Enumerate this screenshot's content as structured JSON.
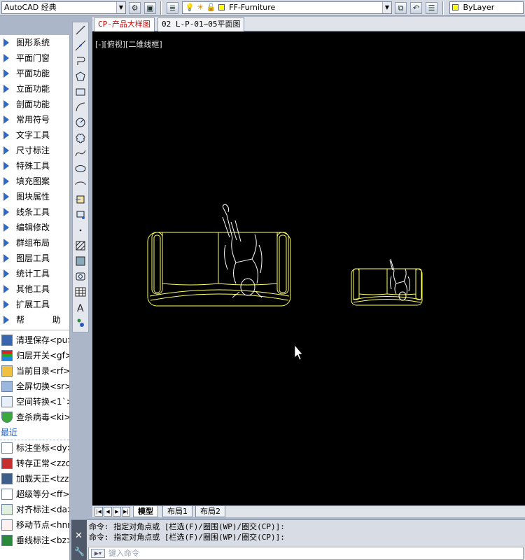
{
  "toolbar": {
    "workspace": "AutoCAD 经典",
    "layer": "FF-Furniture",
    "color": "ByLayer",
    "layer_color": "#ffff00"
  },
  "left_menu": {
    "items": [
      "图形系统",
      "平面门窗",
      "平面功能",
      "立面功能",
      "剖面功能",
      "常用符号",
      "文字工具",
      "尺寸标注",
      "特殊工具",
      "填充图案",
      "图块属性",
      "线条工具",
      "编辑修改",
      "群组布局",
      "图层工具",
      "统计工具",
      "其他工具",
      "扩展工具",
      "帮 助"
    ],
    "tools": [
      "清理保存<pu>",
      "归层开关<gf>",
      "当前目录<rf>",
      "全屏切换<sr>",
      "空间转换<1`>",
      "查杀病毒<ki>"
    ],
    "recent_title": "最近",
    "recent": [
      "标注坐标<dy>",
      "转存正常<zzc",
      "加载天正<tzz",
      "超级等分<ff>",
      "对齐标注<da>",
      "移动节点<hnn",
      "垂线标注<bz>"
    ]
  },
  "doc_tabs": [
    "CP-产品大样图",
    "02 L-P-01~05平面图"
  ],
  "viewport": {
    "label": "[-][俯视][二维线框]",
    "background": "#000000",
    "line_color": "#ffff66"
  },
  "layout_tabs": [
    "模型",
    "布局1",
    "布局2"
  ],
  "command": {
    "history": [
      "命令: 指定对角点或 [栏选(F)/圈围(WP)/圈交(CP)]:",
      "命令: 指定对角点或 [栏选(F)/圈围(WP)/圈交(CP)]:"
    ],
    "input_placeholder": "键入命令"
  }
}
